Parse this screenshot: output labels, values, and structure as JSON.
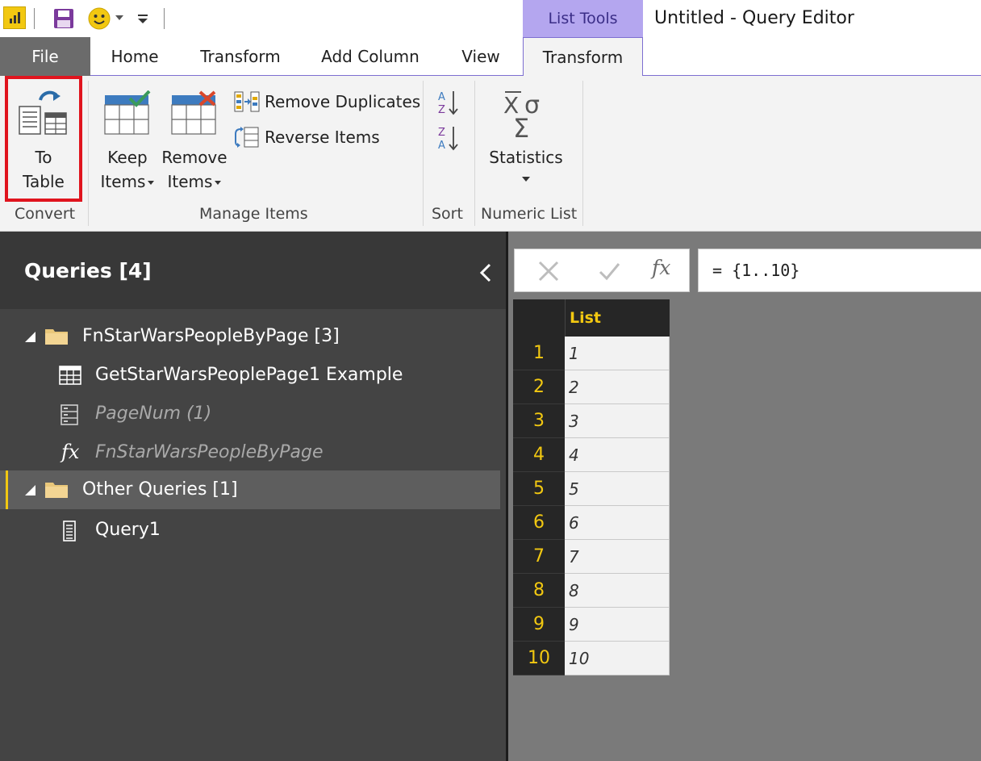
{
  "window": {
    "title": "Untitled - Query Editor",
    "contextual_tab_group": "List Tools"
  },
  "quick_access": {
    "icons": [
      "power-bi-logo-icon",
      "save-icon",
      "smiley-icon",
      "customize-toolbar-icon"
    ]
  },
  "tabs": {
    "file": "File",
    "home": "Home",
    "transform": "Transform",
    "add_column": "Add Column",
    "view": "View",
    "list_transform": "Transform"
  },
  "ribbon": {
    "convert": {
      "group_label": "Convert",
      "to_table_line1": "To",
      "to_table_line2": "Table"
    },
    "manage_items": {
      "group_label": "Manage Items",
      "keep_line1": "Keep",
      "keep_line2": "Items",
      "remove_line1": "Remove",
      "remove_line2": "Items",
      "remove_duplicates": "Remove Duplicates",
      "reverse_items": "Reverse Items"
    },
    "sort": {
      "group_label": "Sort"
    },
    "numeric_list": {
      "group_label": "Numeric List",
      "statistics": "Statistics"
    }
  },
  "queries_pane": {
    "title": "Queries [4]",
    "groups": [
      {
        "label": "FnStarWarsPeopleByPage [3]",
        "items": [
          {
            "label": "GetStarWarsPeoplePage1 Example",
            "icon": "table-icon"
          },
          {
            "label": "PageNum (1)",
            "icon": "parameter-icon"
          },
          {
            "label": "FnStarWarsPeopleByPage",
            "icon": "function-icon"
          }
        ]
      },
      {
        "label": "Other Queries [1]",
        "items": [
          {
            "label": "Query1",
            "icon": "list-icon"
          }
        ]
      }
    ]
  },
  "formula_bar": {
    "fx_label": "fx",
    "formula": "= {1..10}"
  },
  "grid": {
    "column_header": "List",
    "rows": [
      {
        "num": "1",
        "value": "1"
      },
      {
        "num": "2",
        "value": "2"
      },
      {
        "num": "3",
        "value": "3"
      },
      {
        "num": "4",
        "value": "4"
      },
      {
        "num": "5",
        "value": "5"
      },
      {
        "num": "6",
        "value": "6"
      },
      {
        "num": "7",
        "value": "7"
      },
      {
        "num": "8",
        "value": "8"
      },
      {
        "num": "9",
        "value": "9"
      },
      {
        "num": "10",
        "value": "10"
      }
    ]
  },
  "colors": {
    "accent_yellow": "#f2c811",
    "contextual_tab": "#b4a6ef",
    "highlight_red": "#e0141e",
    "pane_bg": "#444444",
    "grid_bg": "#7a7a7a"
  }
}
